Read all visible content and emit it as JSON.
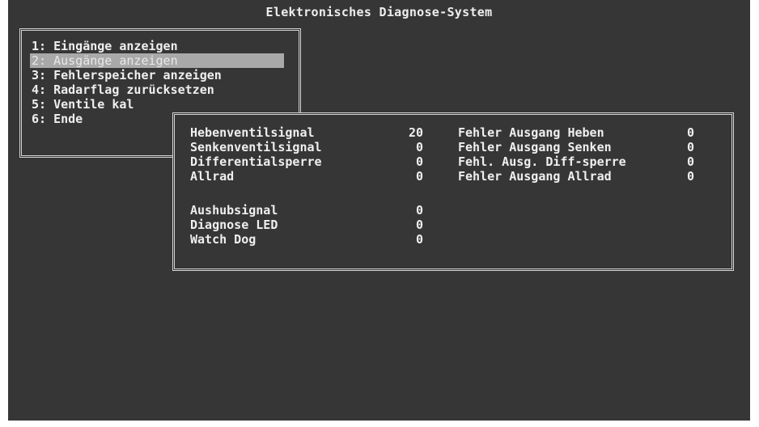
{
  "title": "Elektronisches Diagnose-System",
  "colors": {
    "screen_bg": "#363636",
    "text": "#efefef",
    "selection_bg": "#a9a9a9",
    "frame": "#d4d4d4"
  },
  "menu": {
    "items": [
      {
        "label": "1: Eingänge anzeigen"
      },
      {
        "label": "2: Ausgänge anzeigen",
        "selected": true
      },
      {
        "label": "3: Fehlerspeicher anzeigen"
      },
      {
        "label": "4: Radarflag zurücksetzen"
      },
      {
        "label": "5: Ventile kal"
      },
      {
        "label": "6: Ende"
      }
    ]
  },
  "outputs": {
    "left": [
      {
        "label": "Hebenventilsignal",
        "value": "20"
      },
      {
        "label": "Senkenventilsignal",
        "value": "0"
      },
      {
        "label": "Differentialsperre",
        "value": "0"
      },
      {
        "label": "Allrad",
        "value": "0"
      },
      {
        "label": "Aushubsignal",
        "value": "0"
      },
      {
        "label": "Diagnose LED",
        "value": "0"
      },
      {
        "label": "Watch Dog",
        "value": "0"
      }
    ],
    "right": [
      {
        "label": "Fehler Ausgang Heben",
        "value": "0"
      },
      {
        "label": "Fehler Ausgang Senken",
        "value": "0"
      },
      {
        "label": "Fehl. Ausg. Diff-sperre",
        "value": "0"
      },
      {
        "label": "Fehler Ausgang Allrad",
        "value": "0"
      }
    ]
  }
}
